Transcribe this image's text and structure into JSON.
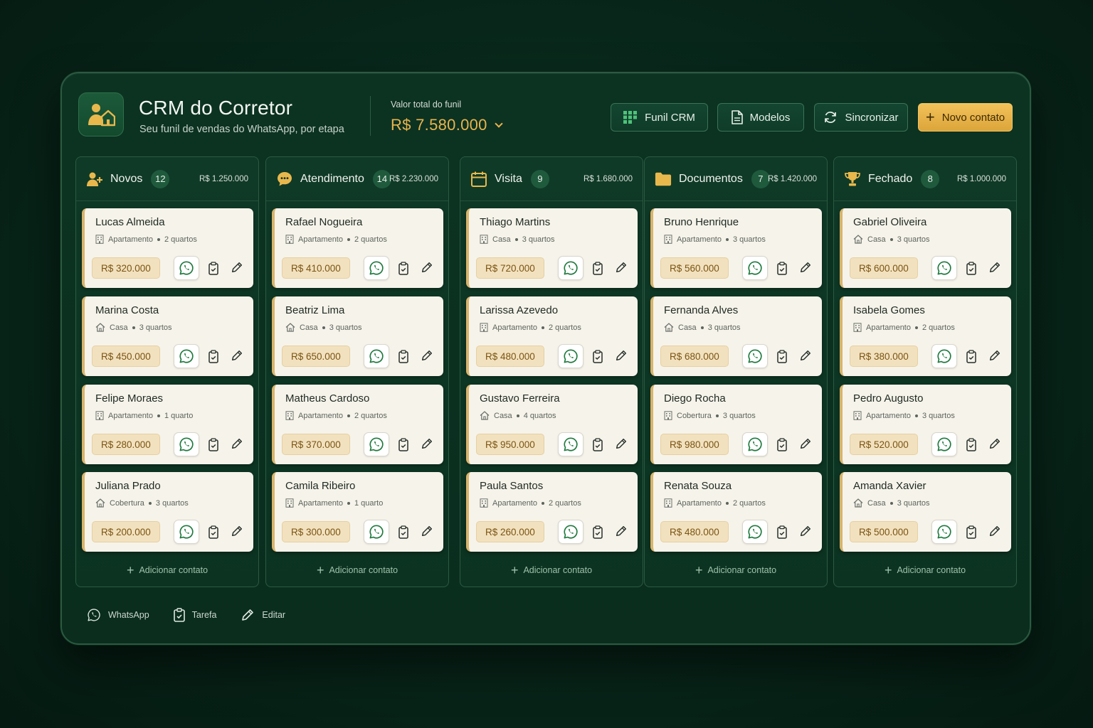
{
  "header": {
    "title": "CRM do Corretor",
    "subtitle": "Seu funil de vendas do WhatsApp, por etapa",
    "total_label": "Valor total do funil",
    "total_value": "R$ 7.580.000"
  },
  "buttons": {
    "funil": "Funil CRM",
    "modelos": "Modelos",
    "sincronizar": "Sincronizar",
    "novo": "Novo contato"
  },
  "colors": {
    "accent": "#e9b44c",
    "background": "#0a2d1e",
    "card": "#f6f3ea",
    "whatsapp": "#1e7a3e"
  },
  "columns": [
    {
      "icon": "user-add-icon",
      "title": "Novos",
      "count": "12",
      "total": "R$ 1.250.000",
      "add_label": "Adicionar contato",
      "cards": [
        {
          "name": "Lucas Almeida",
          "type": "Apartamento",
          "rooms": "2 quartos",
          "price": "R$ 320.000",
          "type_icon": "building-icon"
        },
        {
          "name": "Marina Costa",
          "type": "Casa",
          "rooms": "3 quartos",
          "price": "R$ 450.000",
          "type_icon": "house-icon"
        },
        {
          "name": "Felipe Moraes",
          "type": "Apartamento",
          "rooms": "1 quarto",
          "price": "R$ 280.000",
          "type_icon": "building-icon"
        },
        {
          "name": "Juliana Prado",
          "type": "Cobertura",
          "rooms": "3 quartos",
          "price": "R$ 200.000",
          "type_icon": "house-icon"
        }
      ]
    },
    {
      "icon": "chat-icon",
      "title": "Atendimento",
      "count": "14",
      "total": "R$ 2.230.000",
      "add_label": "Adicionar contato",
      "cards": [
        {
          "name": "Rafael Nogueira",
          "type": "Apartamento",
          "rooms": "2 quartos",
          "price": "R$ 410.000",
          "type_icon": "building-icon"
        },
        {
          "name": "Beatriz Lima",
          "type": "Casa",
          "rooms": "3 quartos",
          "price": "R$ 650.000",
          "type_icon": "house-icon"
        },
        {
          "name": "Matheus Cardoso",
          "type": "Apartamento",
          "rooms": "2 quartos",
          "price": "R$ 370.000",
          "type_icon": "building-icon"
        },
        {
          "name": "Camila Ribeiro",
          "type": "Apartamento",
          "rooms": "1 quarto",
          "price": "R$ 300.000",
          "type_icon": "building-icon"
        }
      ]
    },
    {
      "icon": "calendar-icon",
      "title": "Visita",
      "count": "9",
      "total": "R$ 1.680.000",
      "add_label": "Adicionar contato",
      "cards": [
        {
          "name": "Thiago Martins",
          "type": "Casa",
          "rooms": "3 quartos",
          "price": "R$ 720.000",
          "type_icon": "building-icon"
        },
        {
          "name": "Larissa Azevedo",
          "type": "Apartamento",
          "rooms": "2 quartos",
          "price": "R$ 480.000",
          "type_icon": "building-icon"
        },
        {
          "name": "Gustavo Ferreira",
          "type": "Casa",
          "rooms": "4 quartos",
          "price": "R$ 950.000",
          "type_icon": "house-icon"
        },
        {
          "name": "Paula Santos",
          "type": "Apartamento",
          "rooms": "2 quartos",
          "price": "R$ 260.000",
          "type_icon": "building-icon"
        }
      ]
    },
    {
      "icon": "folder-icon",
      "title": "Documentos",
      "count": "7",
      "total": "R$ 1.420.000",
      "add_label": "Adicionar contato",
      "cards": [
        {
          "name": "Bruno Henrique",
          "type": "Apartamento",
          "rooms": "3 quartos",
          "price": "R$ 560.000",
          "type_icon": "building-icon"
        },
        {
          "name": "Fernanda Alves",
          "type": "Casa",
          "rooms": "3 quartos",
          "price": "R$ 680.000",
          "type_icon": "house-icon"
        },
        {
          "name": "Diego Rocha",
          "type": "Cobertura",
          "rooms": "3 quartos",
          "price": "R$ 980.000",
          "type_icon": "building-icon"
        },
        {
          "name": "Renata Souza",
          "type": "Apartamento",
          "rooms": "2 quartos",
          "price": "R$ 480.000",
          "type_icon": "building-icon"
        }
      ]
    },
    {
      "icon": "trophy-icon",
      "title": "Fechado",
      "count": "8",
      "total": "R$ 1.000.000",
      "add_label": "Adicionar contato",
      "cards": [
        {
          "name": "Gabriel Oliveira",
          "type": "Casa",
          "rooms": "3 quartos",
          "price": "R$ 600.000",
          "type_icon": "house-icon"
        },
        {
          "name": "Isabela Gomes",
          "type": "Apartamento",
          "rooms": "2 quartos",
          "price": "R$ 380.000",
          "type_icon": "building-icon"
        },
        {
          "name": "Pedro Augusto",
          "type": "Apartamento",
          "rooms": "3 quartos",
          "price": "R$ 520.000",
          "type_icon": "building-icon"
        },
        {
          "name": "Amanda Xavier",
          "type": "Casa",
          "rooms": "3 quartos",
          "price": "R$ 500.000",
          "type_icon": "house-icon"
        }
      ]
    }
  ],
  "legend": {
    "whatsapp": "WhatsApp",
    "tarefa": "Tarefa",
    "editar": "Editar"
  }
}
